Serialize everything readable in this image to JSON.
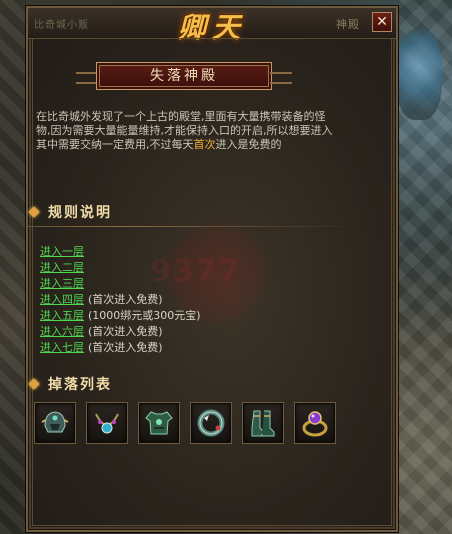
{
  "window": {
    "title": "卿天",
    "tag_left": "比奇城小贩",
    "tag_right": "神殿",
    "close_glyph": "✕"
  },
  "banner": {
    "title": "失落神殿"
  },
  "description": {
    "part1": "在比奇城外发现了一个上古的殿堂,里面有大量携带装备的怪物,因为需要大量能量维持,才能保持入口的开启,所以想要进入其中需要交纳一定费用,不过每天",
    "highlight": "首次",
    "part2": "进入是免费的"
  },
  "rules": {
    "label": "规则说明"
  },
  "floors": [
    {
      "link": "进入一层",
      "note": ""
    },
    {
      "link": "进入二层",
      "note": ""
    },
    {
      "link": "进入三层",
      "note": ""
    },
    {
      "link": "进入四层",
      "note": "(首次进入免费)"
    },
    {
      "link": "进入五层",
      "note": "(1000绑元或300元宝)"
    },
    {
      "link": "进入六层",
      "note": "(首次进入免费)"
    },
    {
      "link": "进入七层",
      "note": "(首次进入免费)"
    }
  ],
  "drops": {
    "label": "掉落列表",
    "items": [
      {
        "icon": "helmet-icon"
      },
      {
        "icon": "necklace-icon"
      },
      {
        "icon": "armor-icon"
      },
      {
        "icon": "bracelet-icon"
      },
      {
        "icon": "boots-icon"
      },
      {
        "icon": "ring-icon"
      }
    ]
  },
  "colors": {
    "accent": "#f2c04a",
    "link": "#4fd84f",
    "highlight": "#f2b23a"
  }
}
